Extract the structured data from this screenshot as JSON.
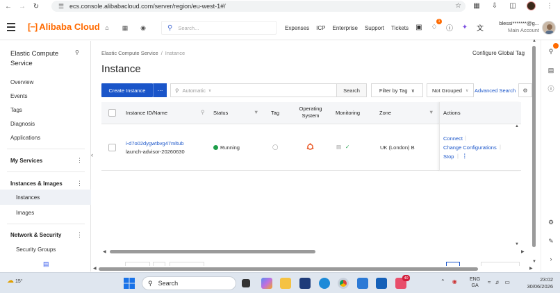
{
  "browser": {
    "url": "ecs.console.alibabacloud.com/server/region/eu-west-1#/"
  },
  "topnav": {
    "brand": "Alibaba Cloud",
    "search_placeholder": "Search...",
    "links": [
      "Expenses",
      "ICP",
      "Enterprise",
      "Support",
      "Tickets"
    ],
    "notification_count": "1",
    "account_name": "blessi*******@g...",
    "account_sub": "Main Account"
  },
  "sidebar": {
    "title": "Elastic Compute Service",
    "items": [
      "Overview",
      "Events",
      "Tags",
      "Diagnosis",
      "Applications"
    ],
    "my_services": "My Services",
    "instances_images": "Instances & Images",
    "instances": "Instances",
    "images": "Images",
    "network_security": "Network & Security",
    "security_groups": "Security Groups"
  },
  "main": {
    "breadcrumb_root": "Elastic Compute Service",
    "breadcrumb_sep": "/",
    "breadcrumb_current": "Instance",
    "configure_tag": "Configure Global Tag",
    "title": "Instance",
    "create_button": "Create Instance",
    "filter_placeholder": "Automatic",
    "search_button": "Search",
    "filter_by_tag": "Filter by Tag",
    "grouping": "Not Grouped",
    "advanced_search": "Advanced Search"
  },
  "table": {
    "columns": {
      "id_name": "Instance ID/Name",
      "status": "Status",
      "tag": "Tag",
      "os_line1": "Operating",
      "os_line2": "System",
      "monitoring": "Monitoring",
      "zone": "Zone",
      "actions": "Actions"
    },
    "rows": [
      {
        "id": "i-d7o02dygwtbvg47mltub",
        "name": "launch-advisor-20260630",
        "status": "Running",
        "zone": "UK (London) B",
        "actions": [
          "Connect",
          "Change Configurations",
          "Stop"
        ]
      }
    ]
  },
  "taskbar": {
    "temperature": "15°",
    "search": "Search",
    "lang1": "ENG",
    "lang2": "GA",
    "time": "23:02",
    "date": "30/06/2026",
    "app_badge": "40"
  },
  "colors": {
    "brand_orange": "#ff6a00",
    "primary_blue": "#1a55c9",
    "running_green": "#1e9e4a"
  }
}
